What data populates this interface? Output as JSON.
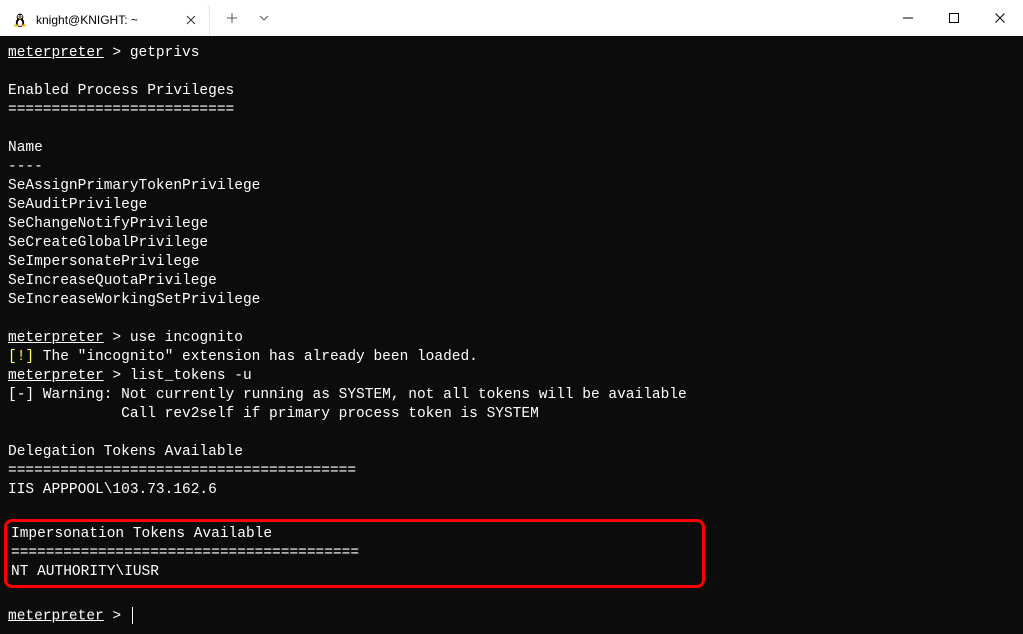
{
  "titlebar": {
    "tab": {
      "title": "knight@KNIGHT: ~",
      "icon_name": "linux-tux-icon"
    }
  },
  "terminal": {
    "prompt": "meterpreter",
    "prompt_sep": " > ",
    "cmd1": "getprivs",
    "section1_header": "Enabled Process Privileges",
    "section1_rule": "==========================",
    "col_name": "Name",
    "col_rule": "----",
    "privs": [
      "SeAssignPrimaryTokenPrivilege",
      "SeAuditPrivilege",
      "SeChangeNotifyPrivilege",
      "SeCreateGlobalPrivilege",
      "SeImpersonatePrivilege",
      "SeIncreaseQuotaPrivilege",
      "SeIncreaseWorkingSetPrivilege"
    ],
    "cmd2": "use incognito",
    "ext_marker": "[!]",
    "ext_loaded": " The \"incognito\" extension has already been loaded.",
    "cmd3": "list_tokens -u",
    "warn_line1": "[-] Warning: Not currently running as SYSTEM, not all tokens will be available",
    "warn_line2": "             Call rev2self if primary process token is SYSTEM",
    "deleg_header": "Delegation Tokens Available",
    "deleg_rule": "========================================",
    "deleg_token": "IIS APPPOOL\\103.73.162.6",
    "impers_header": "Impersonation Tokens Available",
    "impers_rule": "========================================",
    "impers_token": "NT AUTHORITY\\IUSR"
  }
}
